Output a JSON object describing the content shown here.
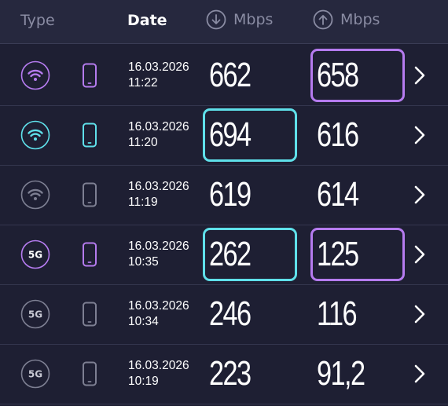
{
  "header": {
    "type_label": "Type",
    "date_label": "Date",
    "download_label": "Mbps",
    "upload_label": "Mbps"
  },
  "colors": {
    "purple": "#b57bef",
    "cyan": "#5fe0ea",
    "gray": "#7d7f92"
  },
  "rows": [
    {
      "type": "wifi",
      "type_icon": "wifi-icon",
      "color": "purple",
      "date": "16.03.2026",
      "time": "11:22",
      "download": "662",
      "upload": "658",
      "highlight_download": false,
      "highlight_upload": true
    },
    {
      "type": "wifi",
      "type_icon": "wifi-icon",
      "color": "cyan",
      "date": "16.03.2026",
      "time": "11:20",
      "download": "694",
      "upload": "616",
      "highlight_download": true,
      "highlight_upload": false
    },
    {
      "type": "wifi",
      "type_icon": "wifi-icon",
      "color": "gray",
      "date": "16.03.2026",
      "time": "11:19",
      "download": "619",
      "upload": "614",
      "highlight_download": false,
      "highlight_upload": false
    },
    {
      "type": "5g",
      "type_icon": "5g-icon",
      "label": "5G",
      "color": "purple",
      "date": "16.03.2026",
      "time": "10:35",
      "download": "262",
      "upload": "125",
      "highlight_download": true,
      "highlight_upload": true
    },
    {
      "type": "5g",
      "type_icon": "5g-icon",
      "label": "5G",
      "color": "gray",
      "date": "16.03.2026",
      "time": "10:34",
      "download": "246",
      "upload": "116",
      "highlight_download": false,
      "highlight_upload": false
    },
    {
      "type": "5g",
      "type_icon": "5g-icon",
      "label": "5G",
      "color": "gray",
      "date": "16.03.2026",
      "time": "10:19",
      "download": "223",
      "upload": "91,2",
      "highlight_download": false,
      "highlight_upload": false
    }
  ]
}
